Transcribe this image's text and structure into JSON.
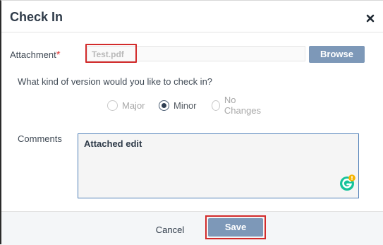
{
  "dialog": {
    "title": "Check In",
    "close_icon": "close-icon"
  },
  "attachment": {
    "label": "Attachment",
    "required_mark": "*",
    "file_name": "Test.pdf",
    "browse_label": "Browse"
  },
  "version": {
    "question": "What kind of version would you like to check in?",
    "options": [
      {
        "label": "Major",
        "selected": false,
        "enabled": false
      },
      {
        "label": "Minor",
        "selected": true,
        "enabled": true
      },
      {
        "label": "No Changes",
        "selected": false,
        "enabled": true
      }
    ]
  },
  "comments": {
    "label": "Comments",
    "value": "Attached edit",
    "assistant_icon": "grammarly-icon"
  },
  "footer": {
    "cancel_label": "Cancel",
    "save_label": "Save"
  },
  "colors": {
    "accent_button": "#7d98b8",
    "highlight_red": "#d22b2b",
    "required_red": "#e03a3a",
    "text_dark": "#2f3b49",
    "grammarly_green": "#15c39a",
    "grammarly_alert": "#f5b400"
  }
}
